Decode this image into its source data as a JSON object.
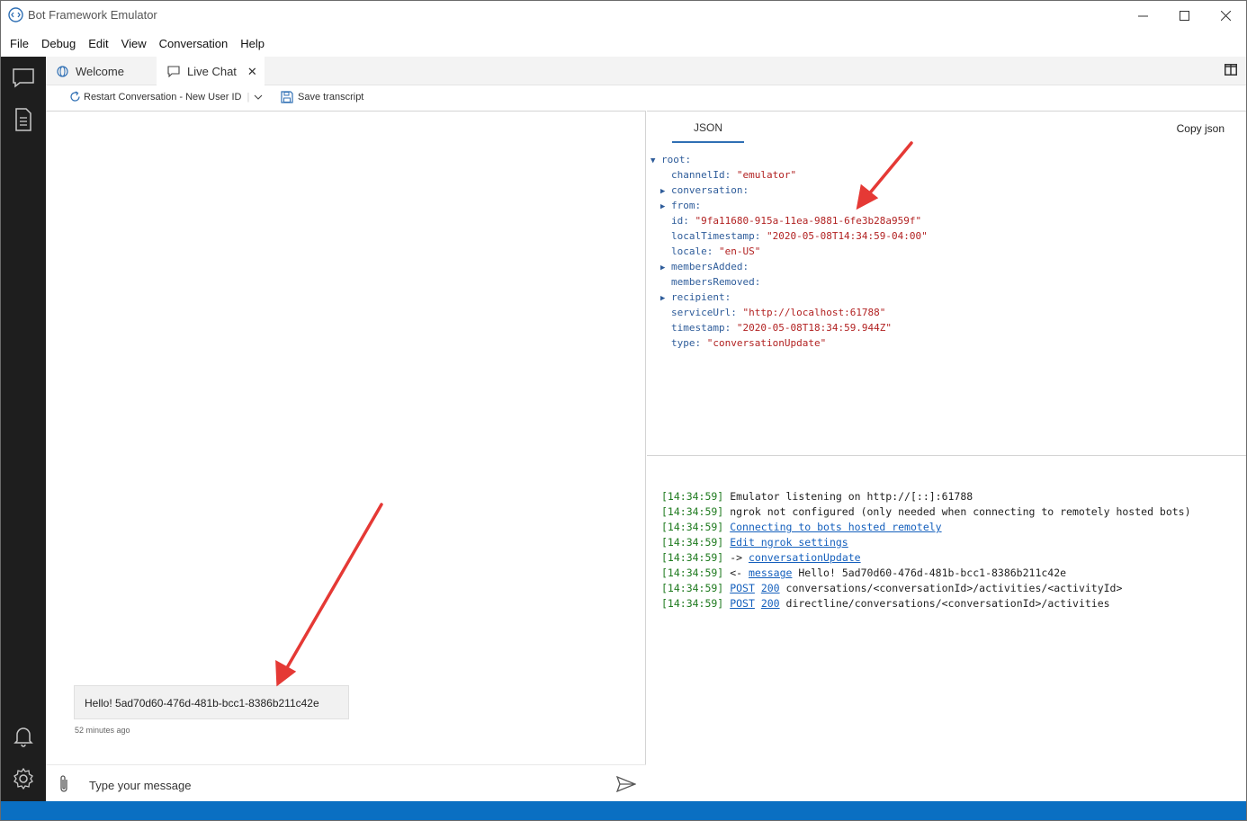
{
  "window": {
    "title": "Bot Framework Emulator"
  },
  "menu": [
    "File",
    "Debug",
    "Edit",
    "View",
    "Conversation",
    "Help"
  ],
  "tabs": [
    {
      "label": "Welcome",
      "icon": "globe-icon"
    },
    {
      "label": "Live Chat",
      "icon": "chat-icon",
      "active": true
    }
  ],
  "toolbar": {
    "restart_label": "Restart Conversation - New User ID",
    "save_label": "Save transcript"
  },
  "chat": {
    "message": "Hello! 5ad70d60-476d-481b-bcc1-8386b211c42e",
    "timestamp": "52 minutes ago",
    "placeholder": "Type your message"
  },
  "inspector": {
    "tab_label": "JSON",
    "copy_label": "Copy json",
    "root_label": "root:",
    "fields": [
      {
        "key": "channelId:",
        "value": "\"emulator\""
      },
      {
        "key": "conversation:",
        "expandable": true
      },
      {
        "key": "from:",
        "expandable": true
      },
      {
        "key": "id:",
        "value": "\"9fa11680-915a-11ea-9881-6fe3b28a959f\""
      },
      {
        "key": "localTimestamp:",
        "value": "\"2020-05-08T14:34:59-04:00\""
      },
      {
        "key": "locale:",
        "value": "\"en-US\""
      },
      {
        "key": "membersAdded:",
        "expandable": true
      },
      {
        "key": "membersRemoved:"
      },
      {
        "key": "recipient:",
        "expandable": true
      },
      {
        "key": "serviceUrl:",
        "value": "\"http://localhost:61788\""
      },
      {
        "key": "timestamp:",
        "value": "\"2020-05-08T18:34:59.944Z\""
      },
      {
        "key": "type:",
        "value": "\"conversationUpdate\""
      }
    ]
  },
  "log": [
    {
      "ts": "[14:34:59]",
      "parts": [
        {
          "text": "Emulator listening on http://[::]:61788"
        }
      ]
    },
    {
      "ts": "[14:34:59]",
      "parts": [
        {
          "text": "ngrok not configured (only needed when connecting to remotely hosted bots)"
        }
      ]
    },
    {
      "ts": "[14:34:59]",
      "parts": [
        {
          "text": "Connecting to bots hosted remotely",
          "link": true
        }
      ]
    },
    {
      "ts": "[14:34:59]",
      "parts": [
        {
          "text": "Edit ngrok settings",
          "link": true
        }
      ]
    },
    {
      "ts": "[14:34:59]",
      "parts": [
        {
          "text": "-> "
        },
        {
          "text": "conversationUpdate",
          "link": true
        }
      ]
    },
    {
      "ts": "[14:34:59]",
      "parts": [
        {
          "text": "<- "
        },
        {
          "text": "message",
          "link": true
        },
        {
          "text": " Hello! 5ad70d60-476d-481b-bcc1-8386b211c42e"
        }
      ]
    },
    {
      "ts": "[14:34:59]",
      "parts": [
        {
          "text": "POST",
          "link": true
        },
        {
          "text": " "
        },
        {
          "text": "200",
          "link": true
        },
        {
          "text": " conversations/<conversationId>/activities/<activityId>"
        }
      ]
    },
    {
      "ts": "[14:34:59]",
      "parts": [
        {
          "text": "POST",
          "link": true
        },
        {
          "text": " "
        },
        {
          "text": "200",
          "link": true
        },
        {
          "text": " directline/conversations/<conversationId>/activities"
        }
      ]
    }
  ],
  "colors": {
    "statusbar": "#0a6fc2",
    "activitybar": "#1e1e1e",
    "accent": "#2f6fb4",
    "annotation_arrow": "#e53935"
  }
}
